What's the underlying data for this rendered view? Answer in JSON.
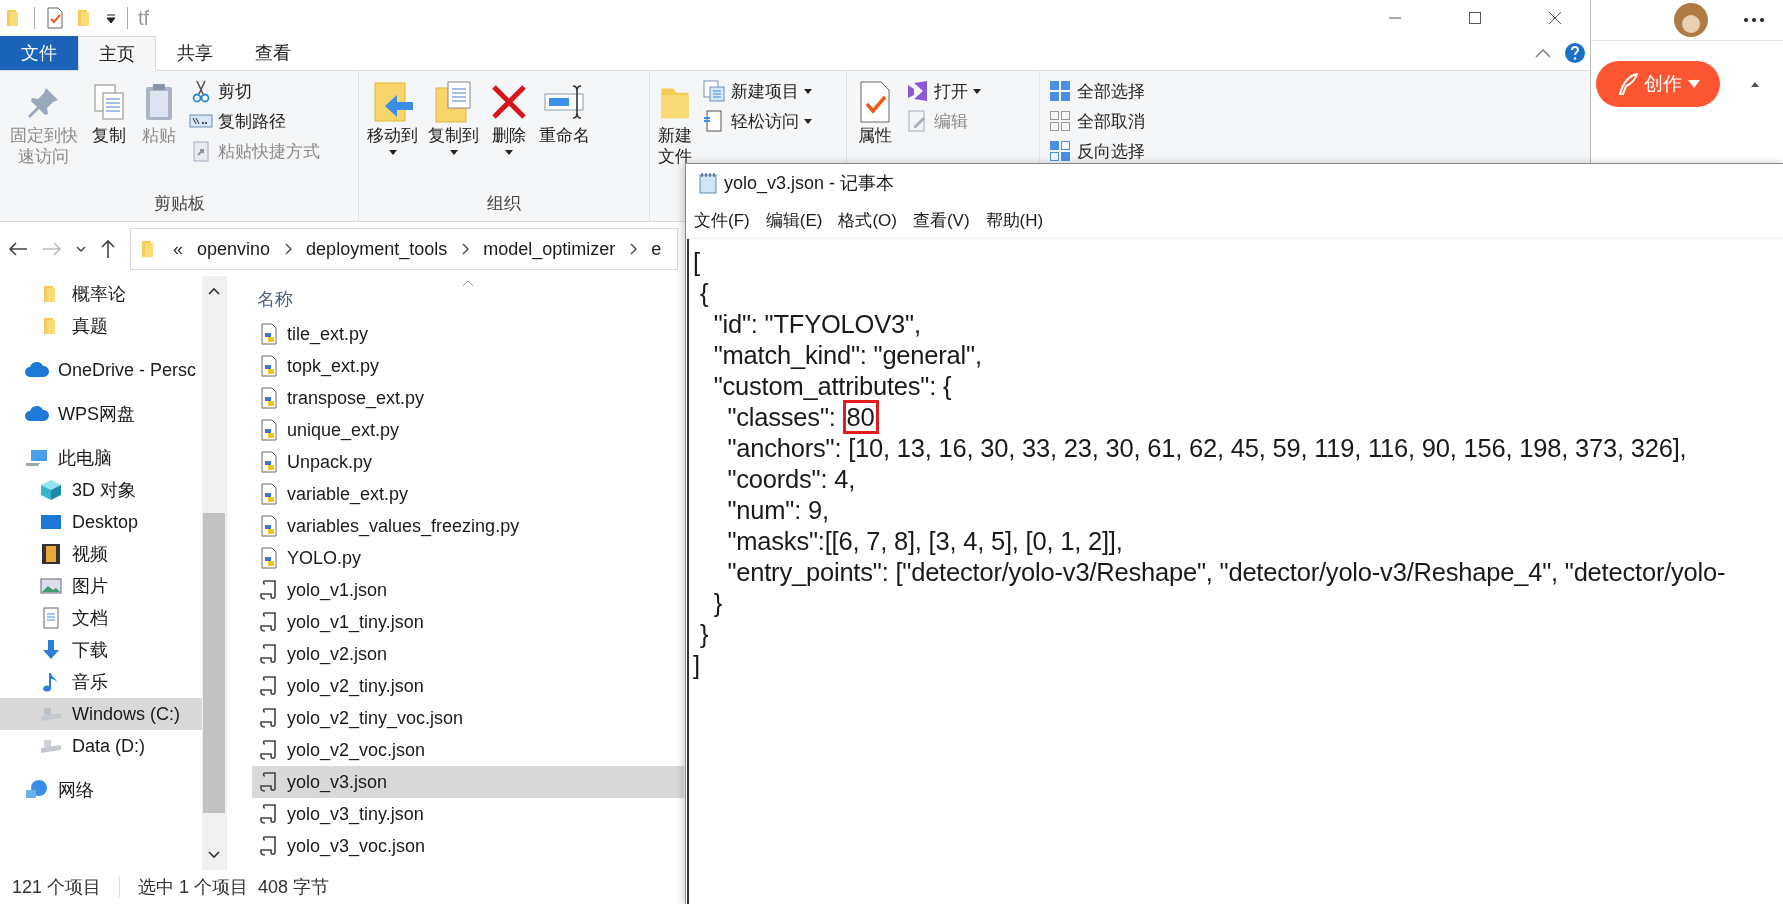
{
  "explorer": {
    "title": "tf",
    "tabs": [
      {
        "label": "文件",
        "kind": "file",
        "selected": false
      },
      {
        "label": "主页",
        "kind": "tab",
        "selected": true
      },
      {
        "label": "共享",
        "kind": "tab",
        "selected": false
      },
      {
        "label": "查看",
        "kind": "tab",
        "selected": false
      }
    ],
    "ribbon": [
      {
        "label": "剪贴板",
        "commands": [
          {
            "label": "固定到快速访问",
            "kind": "large",
            "disabled": true,
            "dropdown": false
          },
          {
            "label": "复制",
            "kind": "large",
            "disabled": false,
            "dropdown": false
          },
          {
            "label": "粘贴",
            "kind": "large",
            "disabled": true,
            "dropdown": false
          },
          {
            "label": "剪切",
            "kind": "small",
            "disabled": false,
            "dropdown": false
          },
          {
            "label": "复制路径",
            "kind": "small",
            "disabled": false,
            "dropdown": false
          },
          {
            "label": "粘贴快捷方式",
            "kind": "small",
            "disabled": true,
            "dropdown": false
          }
        ]
      },
      {
        "label": "组织",
        "commands": [
          {
            "label": "移动到",
            "kind": "large",
            "disabled": false,
            "dropdown": true
          },
          {
            "label": "复制到",
            "kind": "large",
            "disabled": false,
            "dropdown": true
          },
          {
            "label": "删除",
            "kind": "large",
            "disabled": false,
            "dropdown": true
          },
          {
            "label": "重命名",
            "kind": "large",
            "disabled": false,
            "dropdown": false
          }
        ]
      },
      {
        "commands": [
          {
            "label": "新建文件",
            "kind": "large",
            "disabled": false,
            "dropdown": false
          },
          {
            "label": "新建项目",
            "kind": "small",
            "disabled": false,
            "dropdown": true
          },
          {
            "label": "轻松访问",
            "kind": "small",
            "disabled": false,
            "dropdown": true
          }
        ]
      },
      {
        "commands": [
          {
            "label": "属性",
            "kind": "large",
            "disabled": false,
            "dropdown": false
          },
          {
            "label": "打开",
            "kind": "small",
            "disabled": false,
            "dropdown": true
          },
          {
            "label": "编辑",
            "kind": "small",
            "disabled": true,
            "dropdown": false
          }
        ]
      },
      {
        "commands": [
          {
            "label": "全部选择",
            "kind": "small",
            "disabled": false,
            "dropdown": false
          },
          {
            "label": "全部取消",
            "kind": "small",
            "disabled": false,
            "dropdown": false
          },
          {
            "label": "反向选择",
            "kind": "small",
            "disabled": false,
            "dropdown": false
          }
        ]
      }
    ],
    "address": {
      "overflow": "«",
      "crumbs": [
        "openvino",
        "deployment_tools",
        "model_optimizer",
        "e"
      ]
    },
    "nav": {
      "continued_items": [
        {
          "label": "概率论",
          "selected": false
        },
        {
          "label": "真题",
          "selected": false
        }
      ],
      "items": [
        {
          "label": "OneDrive - Persc",
          "selected": false
        },
        {
          "label": "WPS网盘",
          "selected": false
        },
        {
          "label": "此电脑",
          "selected": false,
          "children": [
            {
              "label": "3D 对象",
              "selected": false
            },
            {
              "label": "Desktop",
              "selected": false
            },
            {
              "label": "视频",
              "selected": false
            },
            {
              "label": "图片",
              "selected": false
            },
            {
              "label": "文档",
              "selected": false
            },
            {
              "label": "下载",
              "selected": false
            },
            {
              "label": "音乐",
              "selected": false
            },
            {
              "label": "Windows (C:)",
              "selected": true
            },
            {
              "label": "Data (D:)",
              "selected": false
            }
          ]
        },
        {
          "label": "网络",
          "selected": false
        }
      ]
    },
    "list": {
      "column": "名称",
      "files": [
        {
          "name": "tile_ext.py",
          "selected": false
        },
        {
          "name": "topk_ext.py",
          "selected": false
        },
        {
          "name": "transpose_ext.py",
          "selected": false
        },
        {
          "name": "unique_ext.py",
          "selected": false
        },
        {
          "name": "Unpack.py",
          "selected": false
        },
        {
          "name": "variable_ext.py",
          "selected": false
        },
        {
          "name": "variables_values_freezing.py",
          "selected": false
        },
        {
          "name": "YOLO.py",
          "selected": false
        },
        {
          "name": "yolo_v1.json",
          "selected": false
        },
        {
          "name": "yolo_v1_tiny.json",
          "selected": false
        },
        {
          "name": "yolo_v2.json",
          "selected": false
        },
        {
          "name": "yolo_v2_tiny.json",
          "selected": false
        },
        {
          "name": "yolo_v2_tiny_voc.json",
          "selected": false
        },
        {
          "name": "yolo_v2_voc.json",
          "selected": false
        },
        {
          "name": "yolo_v3.json",
          "selected": true
        },
        {
          "name": "yolo_v3_tiny.json",
          "selected": false
        },
        {
          "name": "yolo_v3_voc.json",
          "selected": false
        }
      ]
    },
    "status_bar": {
      "count": "121 个项目",
      "selection": "选中 1 个项目  408 字节"
    }
  },
  "browser": {
    "create_button": "创作"
  },
  "notepad": {
    "title": "yolo_v3.json - 记事本",
    "menu": [
      "文件(F)",
      "编辑(E)",
      "格式(O)",
      "查看(V)",
      "帮助(H)"
    ],
    "lines": [
      {
        "text": "["
      },
      {
        "text": " {"
      },
      {
        "text": "   \"id\": \"TFYOLOV3\","
      },
      {
        "text": "   \"match_kind\": \"general\","
      },
      {
        "text": "   \"custom_attributes\": {"
      },
      {
        "text": "     \"classes\": ",
        "boxed": "80"
      },
      {
        "text": "     \"anchors\": [10, 13, 16, 30, 33, 23, 30, 61, 62, 45, 59, 119, 116, 90, 156, 198, 373, 326],"
      },
      {
        "text": "     \"coords\": 4,"
      },
      {
        "text": "     \"num\": 9,"
      },
      {
        "text": "     \"masks\":[[6, 7, 8], [3, 4, 5], [0, 1, 2]],"
      },
      {
        "text": "     \"entry_points\": [\"detector/yolo-v3/Reshape\", \"detector/yolo-v3/Reshape_4\", \"detector/yolo-"
      },
      {
        "text": "   }"
      },
      {
        "text": " }"
      },
      {
        "text": "]"
      }
    ]
  }
}
